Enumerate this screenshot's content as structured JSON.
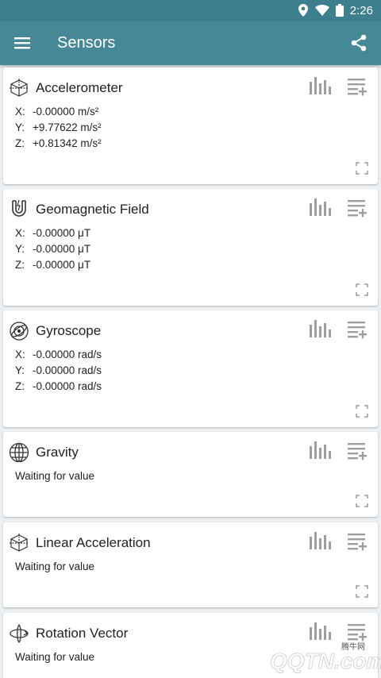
{
  "status_bar": {
    "time": "2:26"
  },
  "app_bar": {
    "title": "Sensors"
  },
  "cards": [
    {
      "name": "Accelerometer",
      "icon": "cube-axes-icon",
      "values": [
        {
          "axis": "X:",
          "value": "-0.00000 m/s²"
        },
        {
          "axis": "Y:",
          "value": "+9.77622 m/s²"
        },
        {
          "axis": "Z:",
          "value": "+0.81342 m/s²"
        }
      ]
    },
    {
      "name": "Geomagnetic Field",
      "icon": "magnet-icon",
      "values": [
        {
          "axis": "X:",
          "value": "-0.00000 μT"
        },
        {
          "axis": "Y:",
          "value": "-0.00000 μT"
        },
        {
          "axis": "Z:",
          "value": "-0.00000 μT"
        }
      ]
    },
    {
      "name": "Gyroscope",
      "icon": "gyroscope-icon",
      "values": [
        {
          "axis": "X:",
          "value": "-0.00000 rad/s"
        },
        {
          "axis": "Y:",
          "value": "-0.00000 rad/s"
        },
        {
          "axis": "Z:",
          "value": "-0.00000 rad/s"
        }
      ]
    },
    {
      "name": "Gravity",
      "icon": "globe-icon",
      "status": "Waiting for value"
    },
    {
      "name": "Linear Acceleration",
      "icon": "cube-axes-icon",
      "status": "Waiting for value"
    },
    {
      "name": "Rotation Vector",
      "icon": "rotation-icon",
      "status": "Waiting for value"
    }
  ],
  "watermark": {
    "text": "QQTN.com",
    "sub": "腾牛网"
  },
  "colors": {
    "status_bar": "#3d7f8c",
    "app_bar": "#468896",
    "icon_grey": "#9e9e9e",
    "background": "#eceff1"
  }
}
